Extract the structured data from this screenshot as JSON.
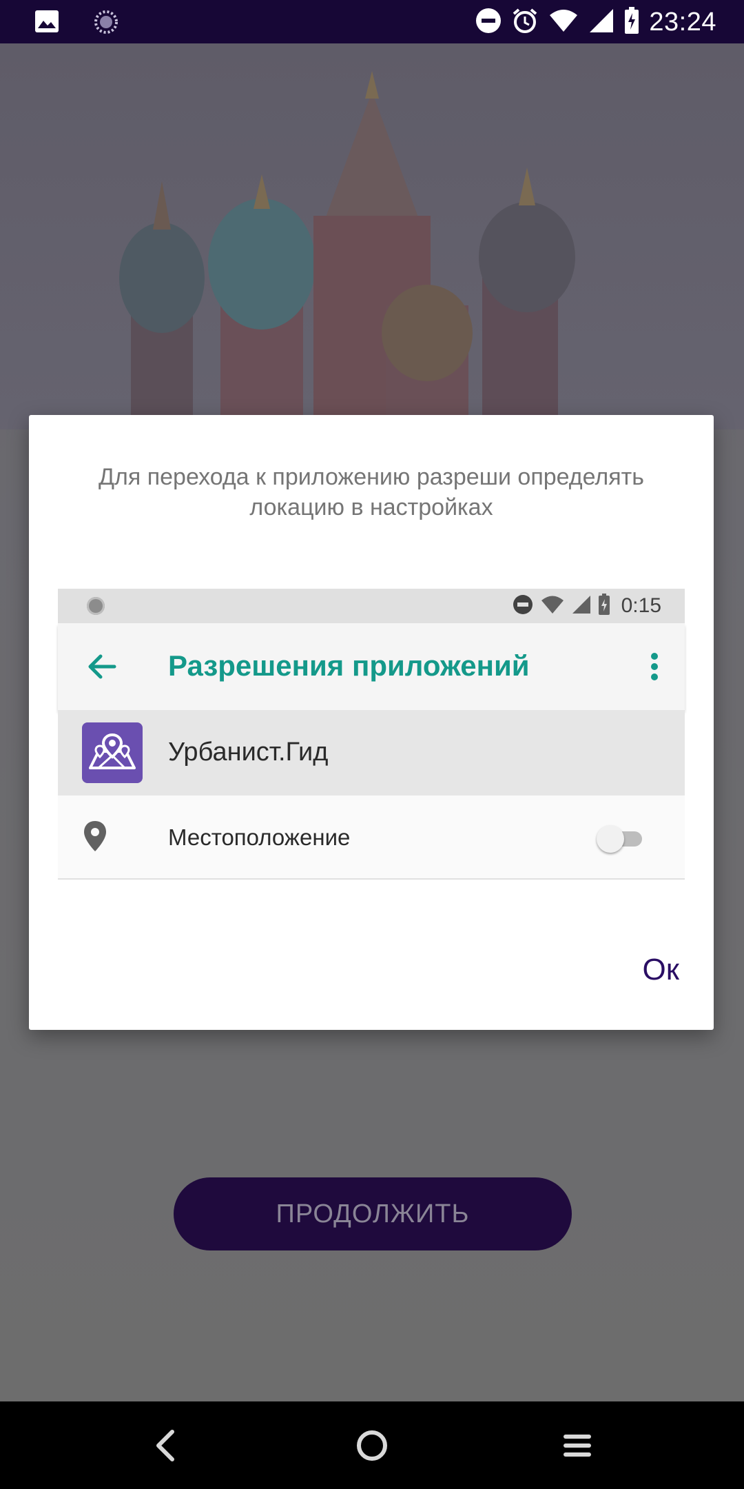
{
  "status_bar": {
    "time": "23:24",
    "icons": [
      "gallery-icon",
      "loading-icon",
      "do-not-disturb-icon",
      "alarm-icon",
      "wifi-icon",
      "cellular-signal-icon",
      "battery-charging-icon"
    ]
  },
  "background": {
    "image": "st-basils-cathedral",
    "continue_label": "ПРОДОЛЖИТЬ"
  },
  "dialog": {
    "message": "Для перехода к приложению разреши определять локацию в настройках",
    "ok_label": "Ок",
    "illustration": {
      "status_time": "0:15",
      "toolbar_title": "Разрешения приложений",
      "app_name": "Урбанист.Гид",
      "permission_label": "Местоположение",
      "permission_enabled": false,
      "accent_color": "#14998a"
    }
  },
  "nav_bar": {
    "buttons": [
      "back-icon",
      "home-icon",
      "recents-icon"
    ]
  },
  "colors": {
    "status_bar": "#170736",
    "ok_text": "#2a0e64",
    "button_bg": "#1f0a3d"
  }
}
